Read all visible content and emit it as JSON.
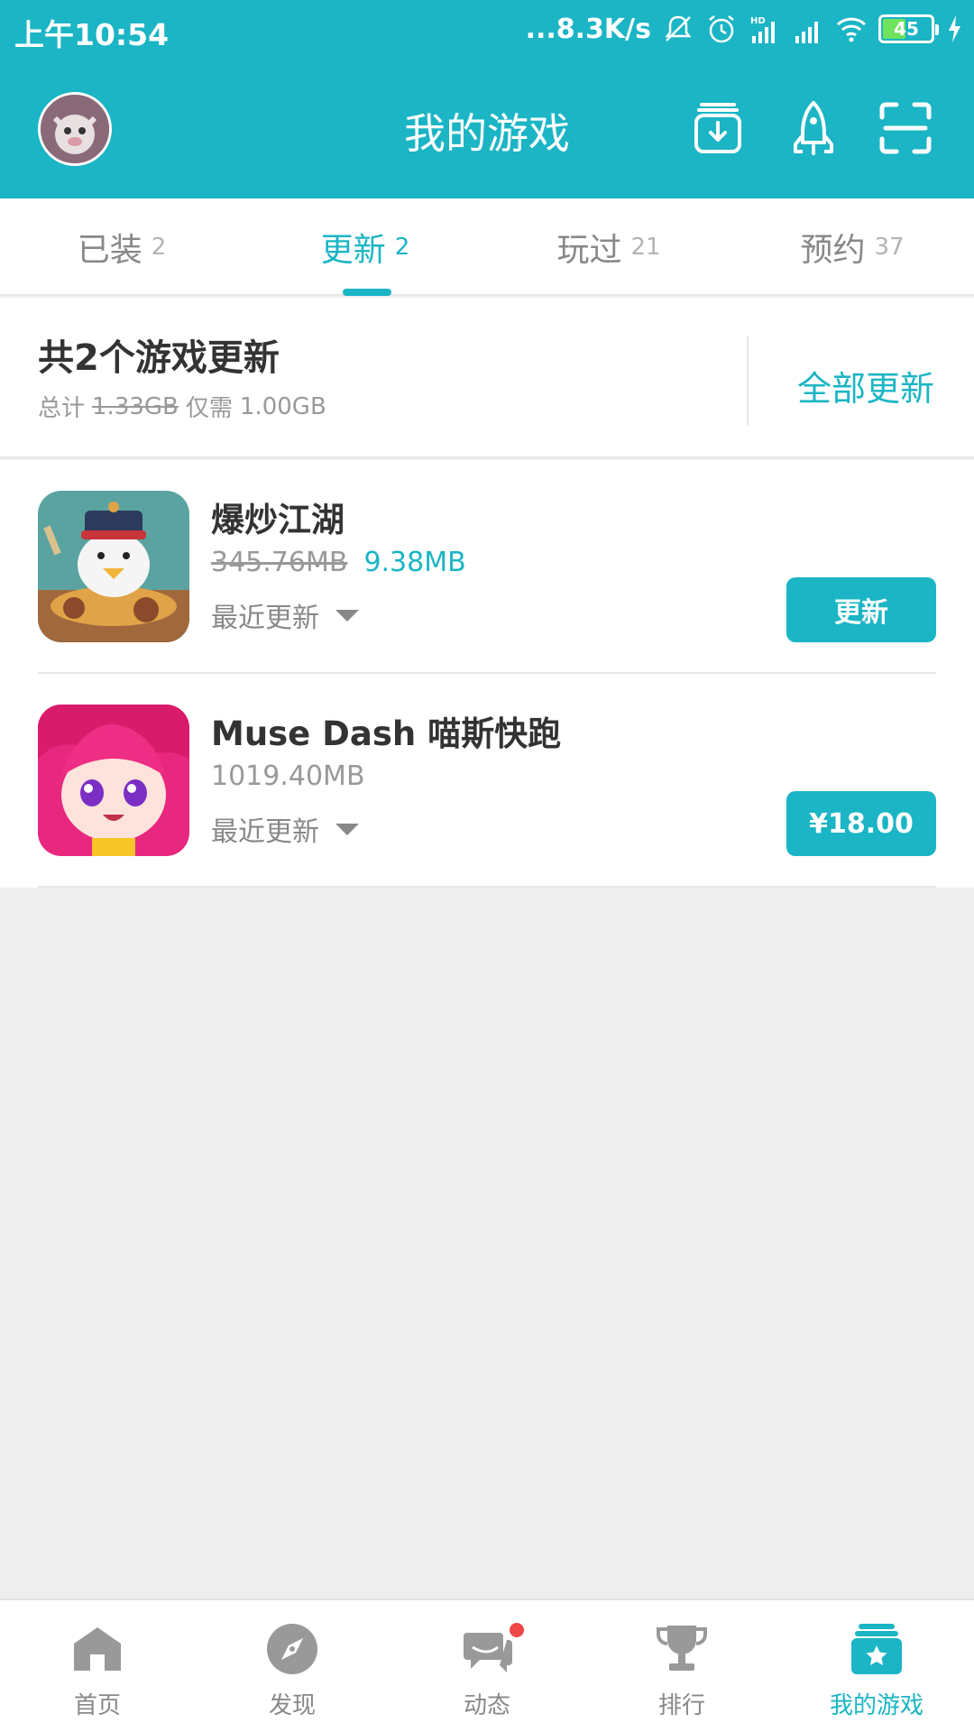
{
  "status_bar": {
    "time": "上午10:54",
    "net_speed": "...8.3K/s",
    "battery_level": "45",
    "icons": [
      "mute-icon",
      "alarm-icon",
      "hd-signal-icon",
      "signal-icon",
      "wifi-icon",
      "battery-icon",
      "charging-icon"
    ]
  },
  "header": {
    "title": "我的游戏",
    "icons": [
      "avatar",
      "download-manager-icon",
      "rocket-icon",
      "scan-icon"
    ]
  },
  "tabs": [
    {
      "label": "已装",
      "count": "2",
      "active": false
    },
    {
      "label": "更新",
      "count": "2",
      "active": true
    },
    {
      "label": "玩过",
      "count": "21",
      "active": false
    },
    {
      "label": "预约",
      "count": "37",
      "active": false
    }
  ],
  "summary": {
    "title": "共2个游戏更新",
    "total_label": "总计",
    "total_original": "1.33GB",
    "only_need_label": "仅需",
    "only_need_value": "1.00GB",
    "update_all": "全部更新"
  },
  "games": [
    {
      "name": "爆炒江湖",
      "size_original": "345.76MB",
      "size_update": "9.38MB",
      "recent_label": "最近更新",
      "button_label": "更新"
    },
    {
      "name": "Muse Dash 喵斯快跑",
      "size": "1019.40MB",
      "recent_label": "最近更新",
      "button_label": "¥18.00"
    }
  ],
  "bottom_nav": [
    {
      "label": "首页",
      "icon": "home-icon",
      "active": false
    },
    {
      "label": "发现",
      "icon": "compass-icon",
      "active": false
    },
    {
      "label": "动态",
      "icon": "chat-icon",
      "active": false,
      "badge": true
    },
    {
      "label": "排行",
      "icon": "trophy-icon",
      "active": false
    },
    {
      "label": "我的游戏",
      "icon": "my-games-icon",
      "active": true
    }
  ],
  "colors": {
    "accent": "#1bb5c5",
    "badge": "#f04848",
    "background": "#eeeeee"
  }
}
